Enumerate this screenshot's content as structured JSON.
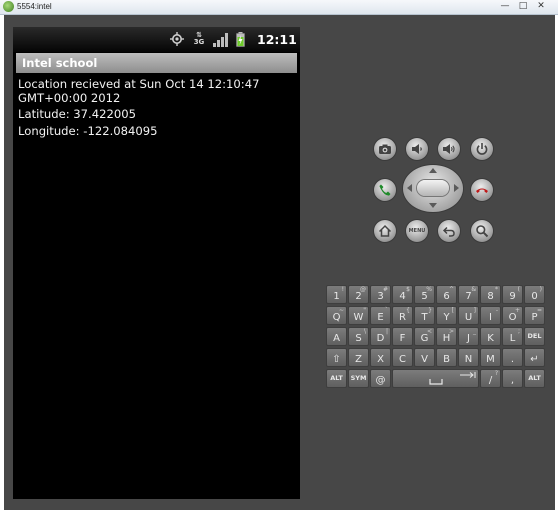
{
  "window": {
    "title": "5554:intel",
    "minimize": "—",
    "maximize": "□",
    "close": "✕"
  },
  "statusbar": {
    "time": "12:11",
    "network_type": "3G",
    "icons": [
      "gps-icon",
      "3g-icon",
      "signal-icon",
      "battery-charging-icon"
    ]
  },
  "app": {
    "title": "Intel school",
    "location_line1": "Location recieved at Sun Oct 14 12:10:47",
    "location_line2": "GMT+00:00 2012",
    "latitude": "Latitude: 37.422005",
    "longitude": "Longitude: -122.084095"
  },
  "controls": {
    "menu_label": "MENU",
    "buttons": [
      "camera-icon",
      "volume-down-icon",
      "volume-up-icon",
      "power-icon",
      "call-icon",
      "end-call-icon",
      "home-icon",
      "menu-button",
      "back-icon",
      "search-icon"
    ]
  },
  "keyboard": {
    "row1": [
      [
        "1",
        "!"
      ],
      [
        "2",
        "@"
      ],
      [
        "3",
        "#"
      ],
      [
        "4",
        "$"
      ],
      [
        "5",
        "%"
      ],
      [
        "6",
        "^"
      ],
      [
        "7",
        "&"
      ],
      [
        "8",
        "*"
      ],
      [
        "9",
        "("
      ],
      [
        "0",
        ")"
      ]
    ],
    "row2": [
      [
        "Q",
        "~"
      ],
      [
        "W",
        "\""
      ],
      [
        "E",
        "`"
      ],
      [
        "R",
        "{"
      ],
      [
        "T",
        "}"
      ],
      [
        "Y",
        "["
      ],
      [
        "U",
        "]"
      ],
      [
        "I",
        "-"
      ],
      [
        "O",
        "+"
      ],
      [
        "P",
        "="
      ]
    ],
    "row3": [
      [
        "A",
        ""
      ],
      [
        "S",
        "\\"
      ],
      [
        "D",
        "|"
      ],
      [
        "F",
        ""
      ],
      [
        "G",
        "<"
      ],
      [
        "H",
        ">"
      ],
      [
        "J",
        "_"
      ],
      [
        "K",
        ""
      ],
      [
        "L",
        ";"
      ],
      [
        "DEL",
        ""
      ]
    ],
    "row4": [
      [
        "⇧",
        ""
      ],
      [
        "Z",
        ""
      ],
      [
        "X",
        ""
      ],
      [
        "C",
        ""
      ],
      [
        "V",
        ""
      ],
      [
        "B",
        ""
      ],
      [
        "N",
        ""
      ],
      [
        "M",
        ""
      ],
      [
        ".",
        ""
      ],
      [
        "↵",
        ""
      ]
    ],
    "row5": [
      [
        "ALT",
        ""
      ],
      [
        "SYM",
        ""
      ],
      [
        "@",
        ""
      ],
      [
        "",
        ""
      ],
      [
        "/",
        "?"
      ],
      [
        ",",
        ""
      ],
      [
        "ALT",
        ""
      ]
    ]
  },
  "colors": {
    "emulator_body": "#474747",
    "screen": "#000000",
    "app_titlebar": "#a5a5a5",
    "call_green": "#1f8a2a",
    "end_call_red": "#c01818"
  }
}
